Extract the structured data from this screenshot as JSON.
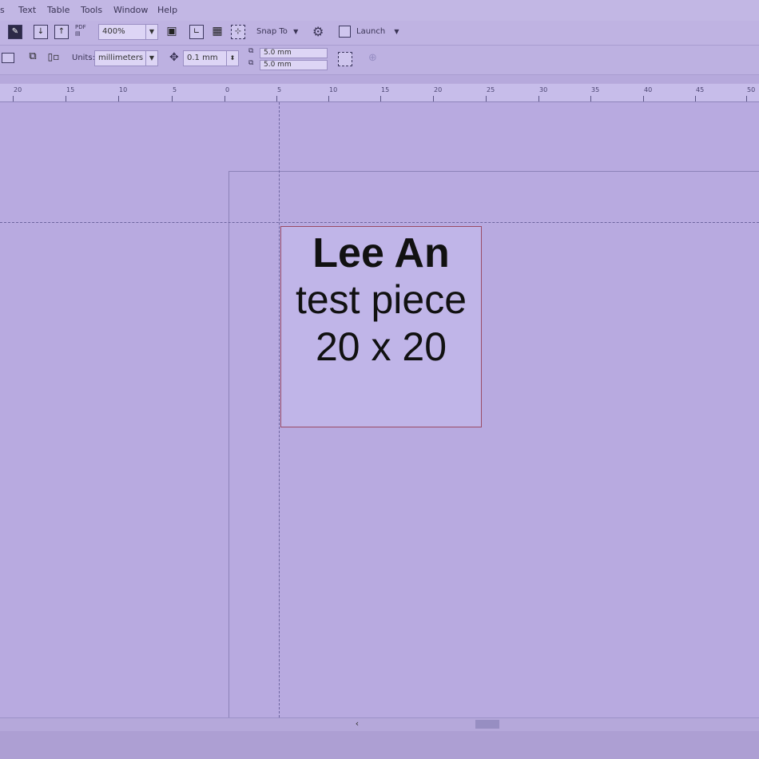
{
  "menu": {
    "items": [
      "s",
      "Text",
      "Table",
      "Tools",
      "Window",
      "Help"
    ]
  },
  "toolbar": {
    "zoom_value": "400%",
    "pdf_label": "PDF",
    "snap_label": "Snap To",
    "launch_label": "Launch",
    "units_label": "Units:",
    "units_value": "millimeters",
    "nudge_value": "0.1 mm",
    "dup_x_value": "5.0 mm",
    "dup_y_value": "5.0 mm"
  },
  "ruler": {
    "labels": [
      "20",
      "15",
      "10",
      "5",
      "0",
      "5",
      "10",
      "15",
      "20",
      "25",
      "30",
      "35",
      "40",
      "45",
      "50"
    ]
  },
  "document": {
    "line1": "Lee An",
    "line2": "test piece",
    "line3": "20 x 20"
  },
  "colors": {
    "background": "#b9acdd",
    "text_frame": "#9a4b66",
    "text": "#111111"
  }
}
